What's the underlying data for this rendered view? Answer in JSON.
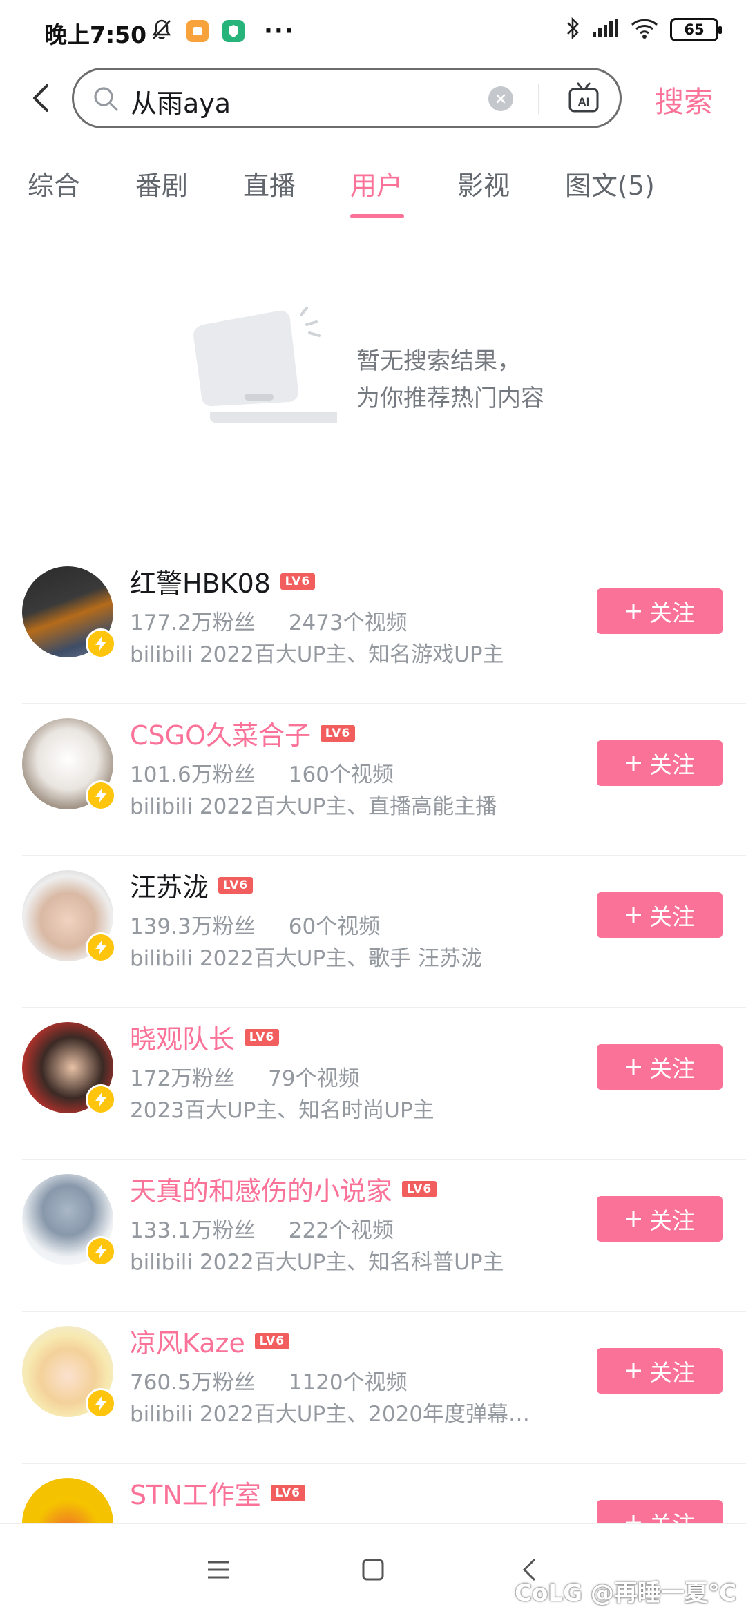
{
  "status_bar": {
    "time": "晚上7:50",
    "battery": "65",
    "icons": [
      "bell-mute-icon",
      "notes-app-icon",
      "shield-app-icon",
      "more-dots-icon",
      "bluetooth-icon",
      "signal-icon",
      "wifi-icon",
      "battery-icon"
    ]
  },
  "search": {
    "query": "从雨aya",
    "submit_label": "搜索",
    "ai_label": "AI"
  },
  "tabs": [
    {
      "label": "综合"
    },
    {
      "label": "番剧"
    },
    {
      "label": "直播"
    },
    {
      "label": "用户",
      "active": true
    },
    {
      "label": "影视"
    },
    {
      "label": "图文(5)"
    }
  ],
  "empty_state": {
    "line1": "暂无搜索结果，",
    "line2": "为你推荐热门内容"
  },
  "users": [
    {
      "name": "红警HBK08",
      "level": "LV6",
      "fans": "177.2万粉丝",
      "videos": "2473个视频",
      "desc": "bilibili 2022百大UP主、知名游戏UP主",
      "name_color": "#18191c",
      "follow": "关注"
    },
    {
      "name": "CSGO久菜合子",
      "level": "LV6",
      "fans": "101.6万粉丝",
      "videos": "160个视频",
      "desc": "bilibili 2022百大UP主、直播高能主播",
      "name_color": "#fb7299",
      "follow": "关注"
    },
    {
      "name": "汪苏泷",
      "level": "LV6",
      "fans": "139.3万粉丝",
      "videos": "60个视频",
      "desc": "bilibili 2022百大UP主、歌手 汪苏泷",
      "name_color": "#18191c",
      "follow": "关注"
    },
    {
      "name": "晓观队长",
      "level": "LV6",
      "fans": "172万粉丝",
      "videos": "79个视频",
      "desc": "2023百大UP主、知名时尚UP主",
      "name_color": "#fb7299",
      "follow": "关注"
    },
    {
      "name": "天真的和感伤的小说家",
      "level": "LV6",
      "fans": "133.1万粉丝",
      "videos": "222个视频",
      "desc": "bilibili 2022百大UP主、知名科普UP主",
      "name_color": "#fb7299",
      "follow": "关注"
    },
    {
      "name": "凉风Kaze",
      "level": "LV6",
      "fans": "760.5万粉丝",
      "videos": "1120个视频",
      "desc": "bilibili 2022百大UP主、2020年度弹幕…",
      "name_color": "#fb7299",
      "follow": "关注"
    },
    {
      "name": "STN工作室",
      "level": "LV6",
      "fans": "",
      "videos": "",
      "desc": "",
      "name_color": "#fb7299",
      "follow": "关注"
    }
  ],
  "watermark": "CoLG @再睡一夏℃",
  "colors": {
    "accent": "#fb7299",
    "text": "#18191c",
    "muted": "#9499a0",
    "level_badge": "#f25d5d",
    "bolt": "#ffc40c"
  }
}
